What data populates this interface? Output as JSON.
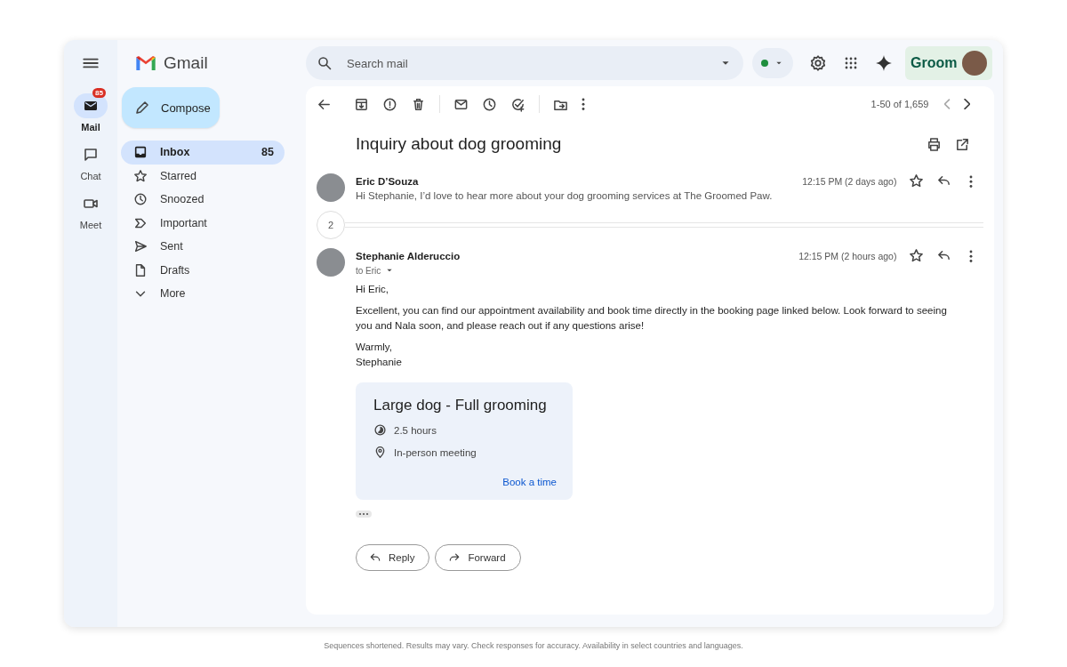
{
  "app": {
    "name": "Gmail"
  },
  "rail": [
    {
      "label": "Mail",
      "selected": true,
      "badge": "85"
    },
    {
      "label": "Chat",
      "selected": false
    },
    {
      "label": "Meet",
      "selected": false
    }
  ],
  "compose": {
    "label": "Compose"
  },
  "folders": [
    {
      "label": "Inbox",
      "count": "85",
      "selected": true
    },
    {
      "label": "Starred",
      "selected": false
    },
    {
      "label": "Snoozed",
      "selected": false
    },
    {
      "label": "Important",
      "selected": false
    },
    {
      "label": "Sent",
      "selected": false
    },
    {
      "label": "Drafts",
      "selected": false
    },
    {
      "label": "More",
      "selected": false
    }
  ],
  "search": {
    "placeholder": "Search mail"
  },
  "account": {
    "brand": "Groom"
  },
  "toolbar": {
    "pagination": "1-50 of 1,659"
  },
  "thread": {
    "subject": "Inquiry about dog grooming",
    "collapsed_count": "2",
    "messages": [
      {
        "sender": "Eric D’Souza",
        "time": "12:15 PM (2 days ago)",
        "expanded": false,
        "snippet": "Hi Stephanie, I’d love to hear more about your dog grooming services at The Groomed Paw."
      },
      {
        "sender": "Stephanie Alderuccio",
        "time": "12:15 PM (2 hours ago)",
        "expanded": true,
        "recipient": "to Eric",
        "body": [
          "Hi Eric,",
          "Excellent, you can find our appointment availability and book time directly in the booking page linked below. Look forward to seeing you and Nala soon, and please reach out if any questions arise!",
          "Warmly,\nStephanie"
        ]
      }
    ]
  },
  "booking": {
    "title": "Large dog - Full grooming",
    "duration": "2.5 hours",
    "location": "In-person meeting",
    "link": "Book a time"
  },
  "actions": [
    "Reply",
    "Forward"
  ],
  "disclaimer": "Sequences shortened. Results may vary. Check responses for accuracy. Availability in select countries and languages."
}
